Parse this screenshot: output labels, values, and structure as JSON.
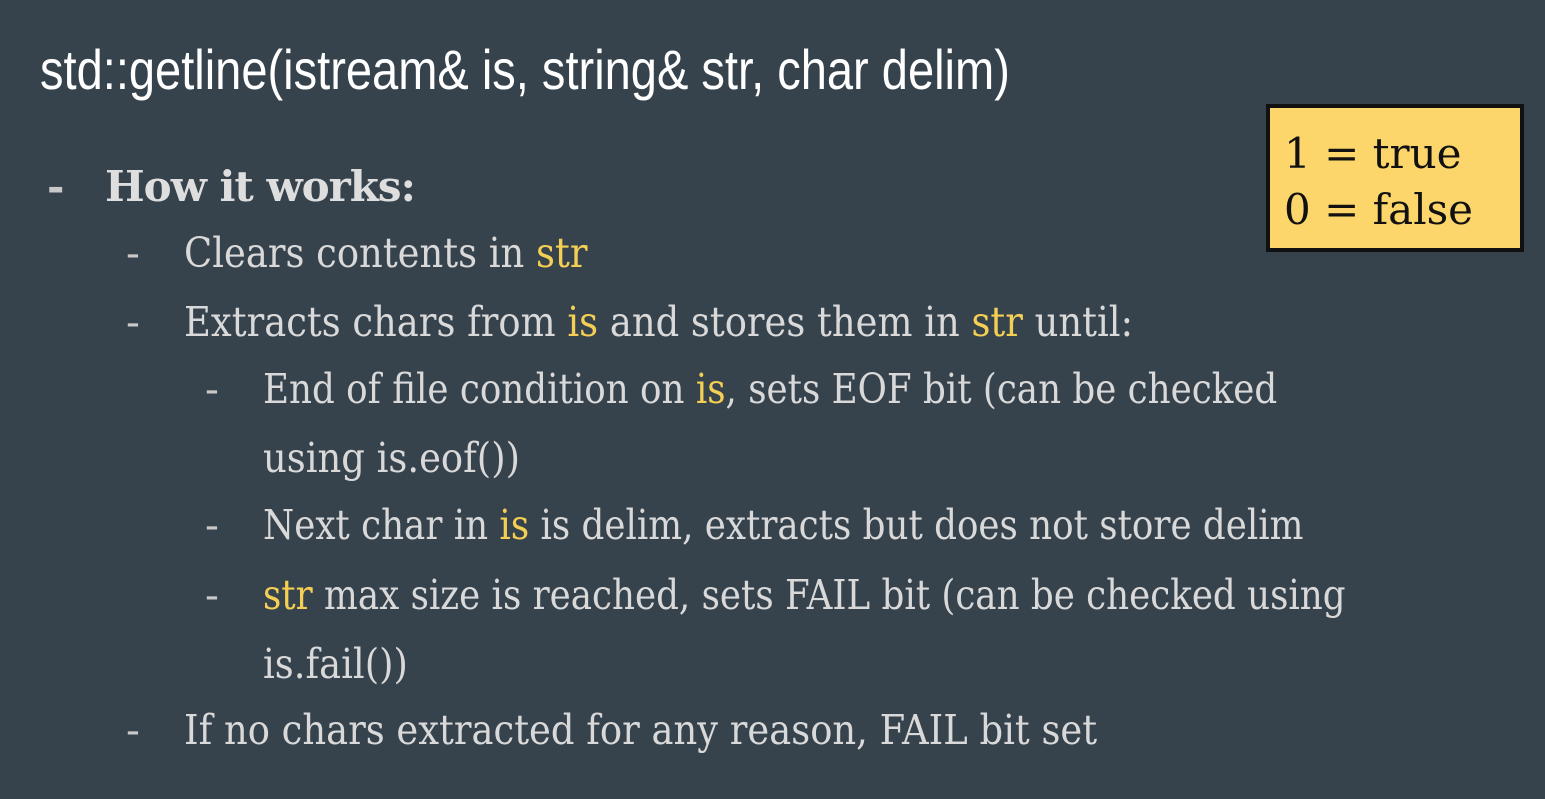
{
  "title": "std::getline(istream& is, string& str, char delim)",
  "legend": {
    "line1": "1 = true",
    "line2": "0 = false"
  },
  "bullets": {
    "how_it_works": "How it works:",
    "clears": {
      "pre": "Clears contents in ",
      "hl": "str"
    },
    "extracts": {
      "pre": "Extracts chars from ",
      "hl1": "is",
      "mid": " and stores them in ",
      "hl2": "str",
      "post": " until:"
    },
    "eof": {
      "pre": "End of file condition on ",
      "hl": "is",
      "post": ", sets EOF bit (can be checked",
      "cont": "using is.eof())"
    },
    "next_char": {
      "pre": "Next char in ",
      "hl": "is",
      "post": " is delim, extracts but does not store delim"
    },
    "max_size": {
      "hl": "str",
      "post": " max size is reached, sets FAIL bit (can be checked using",
      "cont": "is.fail())"
    },
    "no_chars": "If no chars extracted for any reason, FAIL bit set"
  },
  "dash": "-",
  "colors": {
    "background": "#36434d",
    "highlight": "#f5cf54",
    "legend_bg": "#fcd66a",
    "text": "#d9d9d9"
  }
}
